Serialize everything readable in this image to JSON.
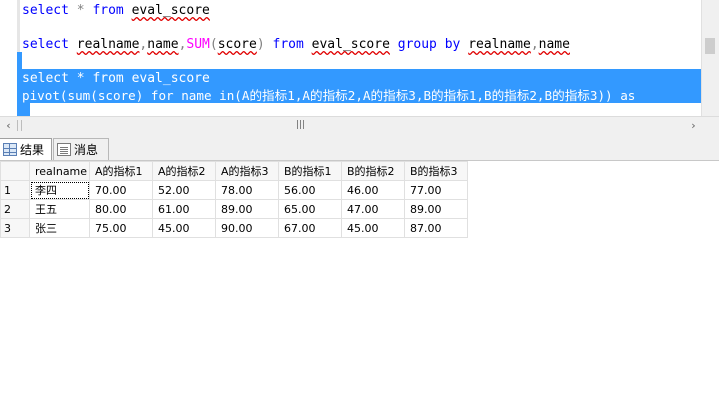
{
  "editor": {
    "line1": {
      "kw1": "select",
      "star": " * ",
      "kw2": "from",
      "tbl": "eval_score"
    },
    "line2": {
      "kw1": "select",
      "c1": "realname",
      "comma1": ",",
      "c2": "name",
      "comma2": ",",
      "fn": "SUM",
      "lp": "(",
      "c3": "score",
      "rp": ")",
      "kw2": "from",
      "tbl": "eval_score",
      "kw3": "group by",
      "c4": "realname",
      "comma3": ",",
      "c5": "name"
    },
    "line3": {
      "text": "select * from eval_score"
    },
    "line4": {
      "text": "pivot(sum(score) for name in(A的指标1,A的指标2,A的指标3,B的指标1,B的指标2,B的指标3)) as"
    }
  },
  "tabs": {
    "results": "结果",
    "messages": "消息"
  },
  "icons": {
    "results_tab": "grid-icon",
    "messages_tab": "messages-icon",
    "scroll_left": "arrow-left-icon",
    "scroll_right": "arrow-right-icon",
    "scroll_grip": "grip-icon"
  },
  "grid": {
    "columns": [
      "realname",
      "A的指标1",
      "A的指标2",
      "A的指标3",
      "B的指标1",
      "B的指标2",
      "B的指标3"
    ],
    "rows": [
      {
        "num": "1",
        "cells": [
          "李四",
          "70.00",
          "52.00",
          "78.00",
          "56.00",
          "46.00",
          "77.00"
        ]
      },
      {
        "num": "2",
        "cells": [
          "王五",
          "80.00",
          "61.00",
          "89.00",
          "65.00",
          "47.00",
          "89.00"
        ]
      },
      {
        "num": "3",
        "cells": [
          "张三",
          "75.00",
          "45.00",
          "90.00",
          "67.00",
          "45.00",
          "87.00"
        ]
      }
    ]
  },
  "colors": {
    "keyword": "#0000ff",
    "function": "#ff00ff",
    "selection": "#3399ff"
  }
}
